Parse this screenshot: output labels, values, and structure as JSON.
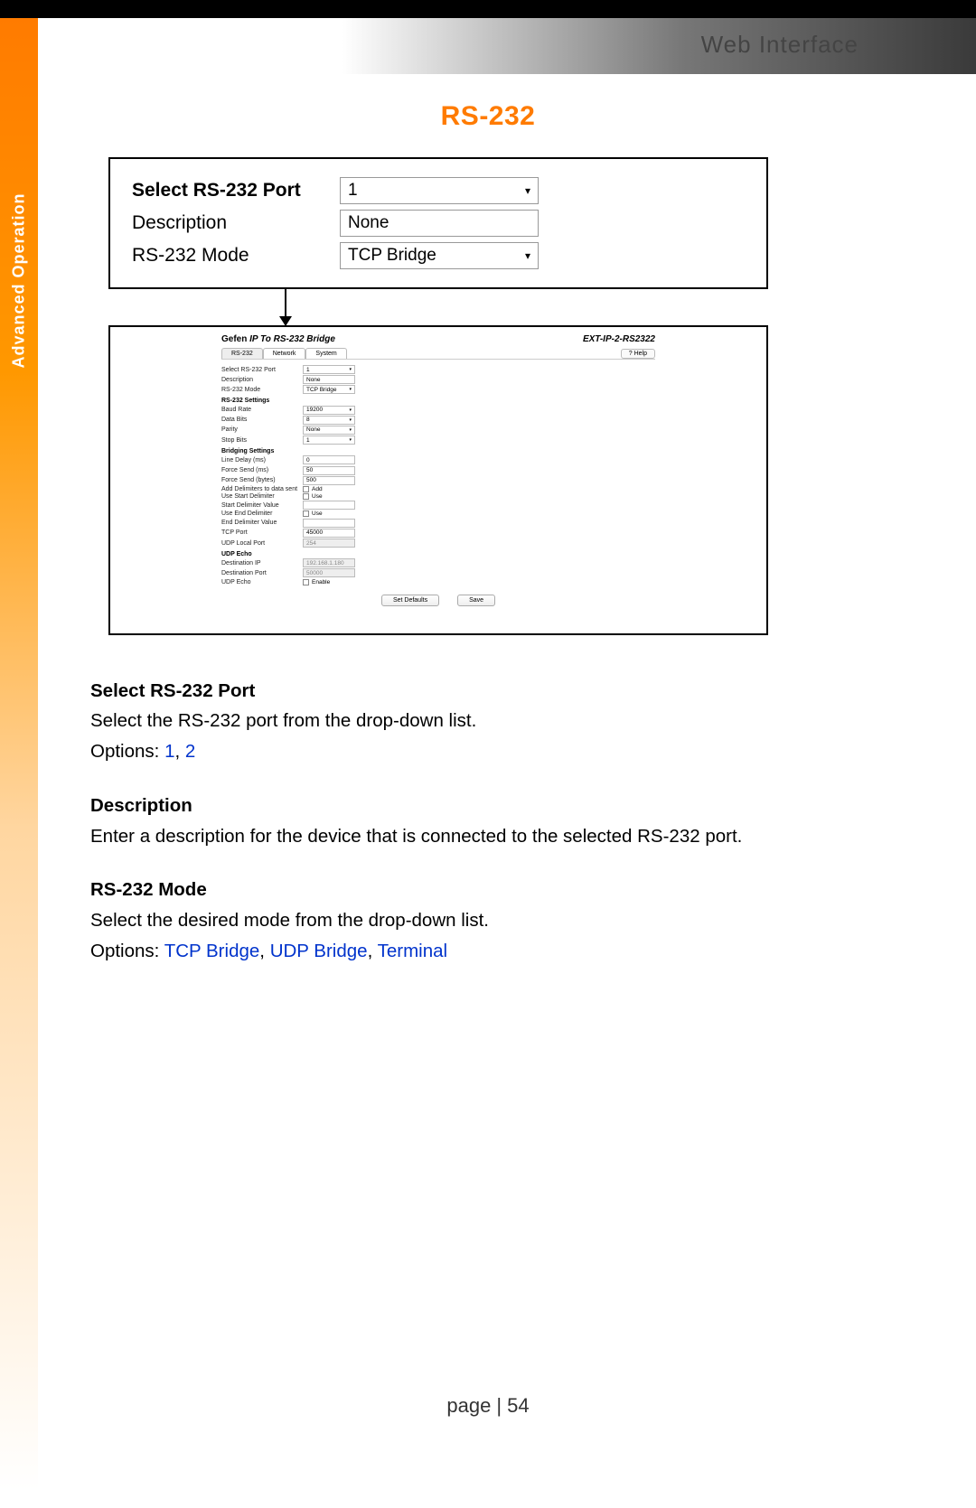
{
  "header": {
    "section": "Web Interface"
  },
  "sidebar": {
    "label": "Advanced Operation"
  },
  "title": "RS-232",
  "mainbox": {
    "row1": {
      "label": "Select RS-232 Port",
      "value": "1"
    },
    "row2": {
      "label": "Description",
      "value": "None"
    },
    "row3": {
      "label": "RS-232 Mode",
      "value": "TCP Bridge"
    }
  },
  "mini": {
    "brand": "Gefen",
    "title_mid": "IP To RS-232 Bridge",
    "model": "EXT-IP-2-RS2322",
    "tabs": [
      "RS-232",
      "Network",
      "System"
    ],
    "help": "? Help",
    "s0_rows": [
      {
        "l": "Select RS-232 Port",
        "v": "1",
        "type": "sel"
      },
      {
        "l": "Description",
        "v": "None",
        "type": "txt"
      },
      {
        "l": "RS-232 Mode",
        "v": "TCP Bridge",
        "type": "sel"
      }
    ],
    "s1": "RS-232 Settings",
    "s1_rows": [
      {
        "l": "Baud Rate",
        "v": "19200",
        "type": "sel"
      },
      {
        "l": "Data Bits",
        "v": "8",
        "type": "sel"
      },
      {
        "l": "Parity",
        "v": "None",
        "type": "sel"
      },
      {
        "l": "Stop Bits",
        "v": "1",
        "type": "sel"
      }
    ],
    "s2": "Bridging Settings",
    "s2_rows": [
      {
        "l": "Line Delay (ms)",
        "v": "0",
        "type": "txt"
      },
      {
        "l": "Force Send (ms)",
        "v": "50",
        "type": "txt"
      },
      {
        "l": "Force Send (bytes)",
        "v": "500",
        "type": "txt"
      },
      {
        "l": "Add Delimiters to data sent",
        "v": "Add",
        "type": "chk"
      },
      {
        "l": "Use Start Delimiter",
        "v": "Use",
        "type": "chk"
      },
      {
        "l": "Start Delimiter Value",
        "v": "",
        "type": "txt"
      },
      {
        "l": "Use End Delimiter",
        "v": "Use",
        "type": "chk"
      },
      {
        "l": "End Delimiter Value",
        "v": "",
        "type": "txt"
      },
      {
        "l": "TCP Port",
        "v": "45000",
        "type": "txt"
      },
      {
        "l": "UDP Local Port",
        "v": "254",
        "type": "dtxt"
      }
    ],
    "s3": "UDP Echo",
    "s3_rows": [
      {
        "l": "Destination IP",
        "v": "192.168.1.180",
        "type": "dtxt"
      },
      {
        "l": "Destination Port",
        "v": "50000",
        "type": "dtxt"
      },
      {
        "l": "UDP Echo",
        "v": "Enable",
        "type": "chk"
      }
    ],
    "actions": {
      "defaults": "Set Defaults",
      "save": "Save"
    }
  },
  "descriptions": {
    "d1": {
      "h": "Select RS-232 Port",
      "p": "Select the RS-232 port from the drop-down list.",
      "opt_label": "Options:",
      "opts": [
        "1",
        "2"
      ]
    },
    "d2": {
      "h": "Description",
      "p": "Enter a description for the device that is connected to the selected RS-232 port."
    },
    "d3": {
      "h": "RS-232 Mode",
      "p": "Select the desired mode from the drop-down list.",
      "opt_label": "Options:",
      "opts": [
        "TCP Bridge",
        "UDP Bridge",
        "Terminal"
      ]
    }
  },
  "footer": {
    "label": "page",
    "sep": "|",
    "num": "54"
  }
}
